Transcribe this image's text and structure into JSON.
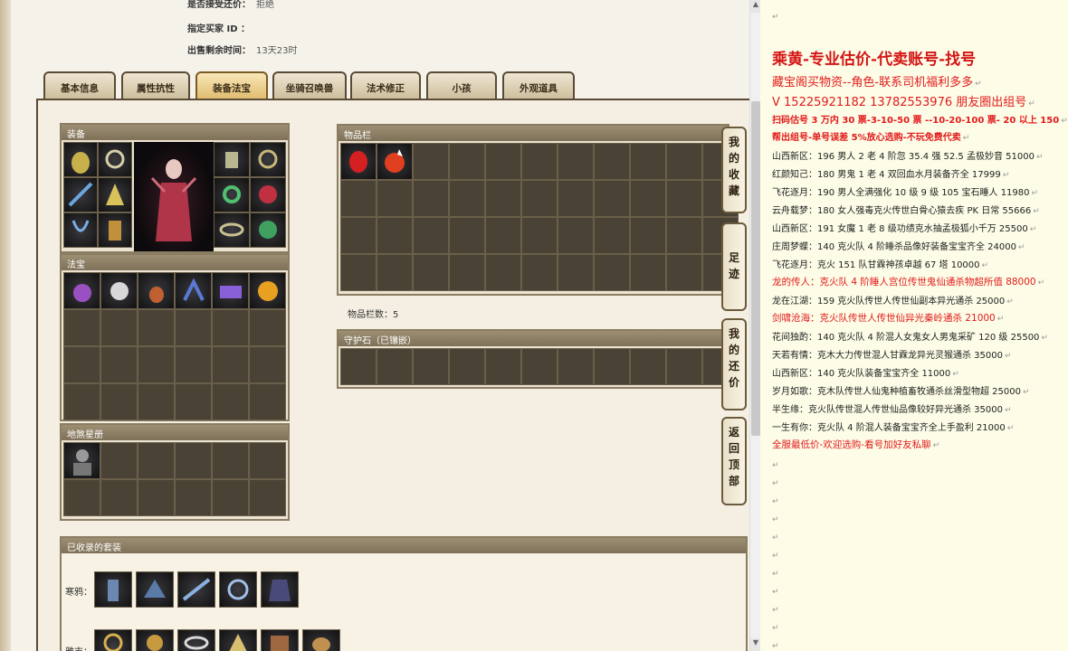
{
  "sale_info": [
    {
      "label": "是否接受还价：",
      "value": "拒绝"
    },
    {
      "label": "指定买家 ID ：",
      "value": ""
    },
    {
      "label": "出售剩余时间：",
      "value": "13天23时"
    }
  ],
  "tabs": [
    "基本信息",
    "属性抗性",
    "装备法宝",
    "坐骑召唤兽",
    "法术修正",
    "小孩",
    "外观道具"
  ],
  "active_tab": "装备法宝",
  "panels": {
    "equipment": "装备",
    "fabao": "法宝",
    "map": "地煞星册",
    "inventory": "物品栏",
    "inventory_count": "物品栏数：5",
    "guard_stone": "守护石（已镶嵌）",
    "suits": "已收录的套装"
  },
  "suits": [
    {
      "label": "寒鸦："
    },
    {
      "label": "雅吉："
    }
  ],
  "side_buttons": [
    "我的收藏",
    "足迹",
    "我的还价",
    "返回顶部"
  ],
  "notes": {
    "title": "乘黄-专业估价-代卖账号-找号",
    "lines": [
      {
        "text": "藏宝阁买物资--角色-联系司机福利多多",
        "style": "red-large"
      },
      {
        "text": "V 15225921182    13782553976 朋友圈出组号",
        "style": "red-large"
      },
      {
        "text": "扫码估号 3 万内 30 票-3-10-50 票  --10-20-100 票- 20 以上 150",
        "style": "red-bold"
      },
      {
        "text": "帮出组号-单号误差 5%放心选购-不玩免费代卖",
        "style": "red-bold"
      },
      {
        "text": "山西新区：196 男人 2 老 4 阶忽 35.4 强 52.5 孟极妙音 51000",
        "style": "dark"
      },
      {
        "text": "红颜知己：180 男鬼 1 老 4 双回血水月装备齐全 17999",
        "style": "dark"
      },
      {
        "text": "飞花逐月：190 男人全满强化 10 级 9 级 105 宝石睡人 11980",
        "style": "dark"
      },
      {
        "text": "云舟载梦：180 女人强毒克火传世白骨心猿去疾 PK 日常 55666",
        "style": "dark"
      },
      {
        "text": "山西新区：191 女魔 1 老 8 级功绩克水抽孟极狐小千万 25500",
        "style": "dark"
      },
      {
        "text": "庄周梦蝶：140 克火队 4 阶睡杀品像好装备宝宝齐全 24000",
        "style": "dark"
      },
      {
        "text": "飞花逐月：克火 151 队甘霖神孩卓越 67 塔 10000",
        "style": "dark"
      },
      {
        "text": "龙的传人：克火队 4 阶睡人宫位传世鬼仙通杀物超所值 88000",
        "style": "red"
      },
      {
        "text": "龙在江湖：159 克火队传世人传世仙副本异光通杀 25000",
        "style": "dark"
      },
      {
        "text": "剑啸沧海：克火队传世人传世仙异光秦岭通杀 21000",
        "style": "red"
      },
      {
        "text": "花间独酌：140 克火队 4 阶混人女鬼女人男鬼采矿 120 级 25500",
        "style": "dark"
      },
      {
        "text": "天若有情：克木大力传世混人甘霖龙异光灵猴通杀 35000",
        "style": "dark"
      },
      {
        "text": "山西新区：140 克火队装备宝宝齐全 11000",
        "style": "dark"
      },
      {
        "text": "岁月如歌：克木队传世人仙鬼种植畜牧通杀丝滑型物超 25000",
        "style": "dark"
      },
      {
        "text": "半生缘：克火队传世混人传世仙品像较好异光通杀 35000",
        "style": "dark"
      },
      {
        "text": "一生有你：克火队 4 阶混人装备宝宝齐全上手盈利 21000",
        "style": "dark"
      },
      {
        "text": "全服最低价-欢迎选购-看号加好友私聊",
        "style": "red"
      }
    ]
  },
  "colors": {
    "accent_red": "#e21b1b",
    "panel_frame": "#5a4a35",
    "note_bg": "#fdfce7"
  }
}
